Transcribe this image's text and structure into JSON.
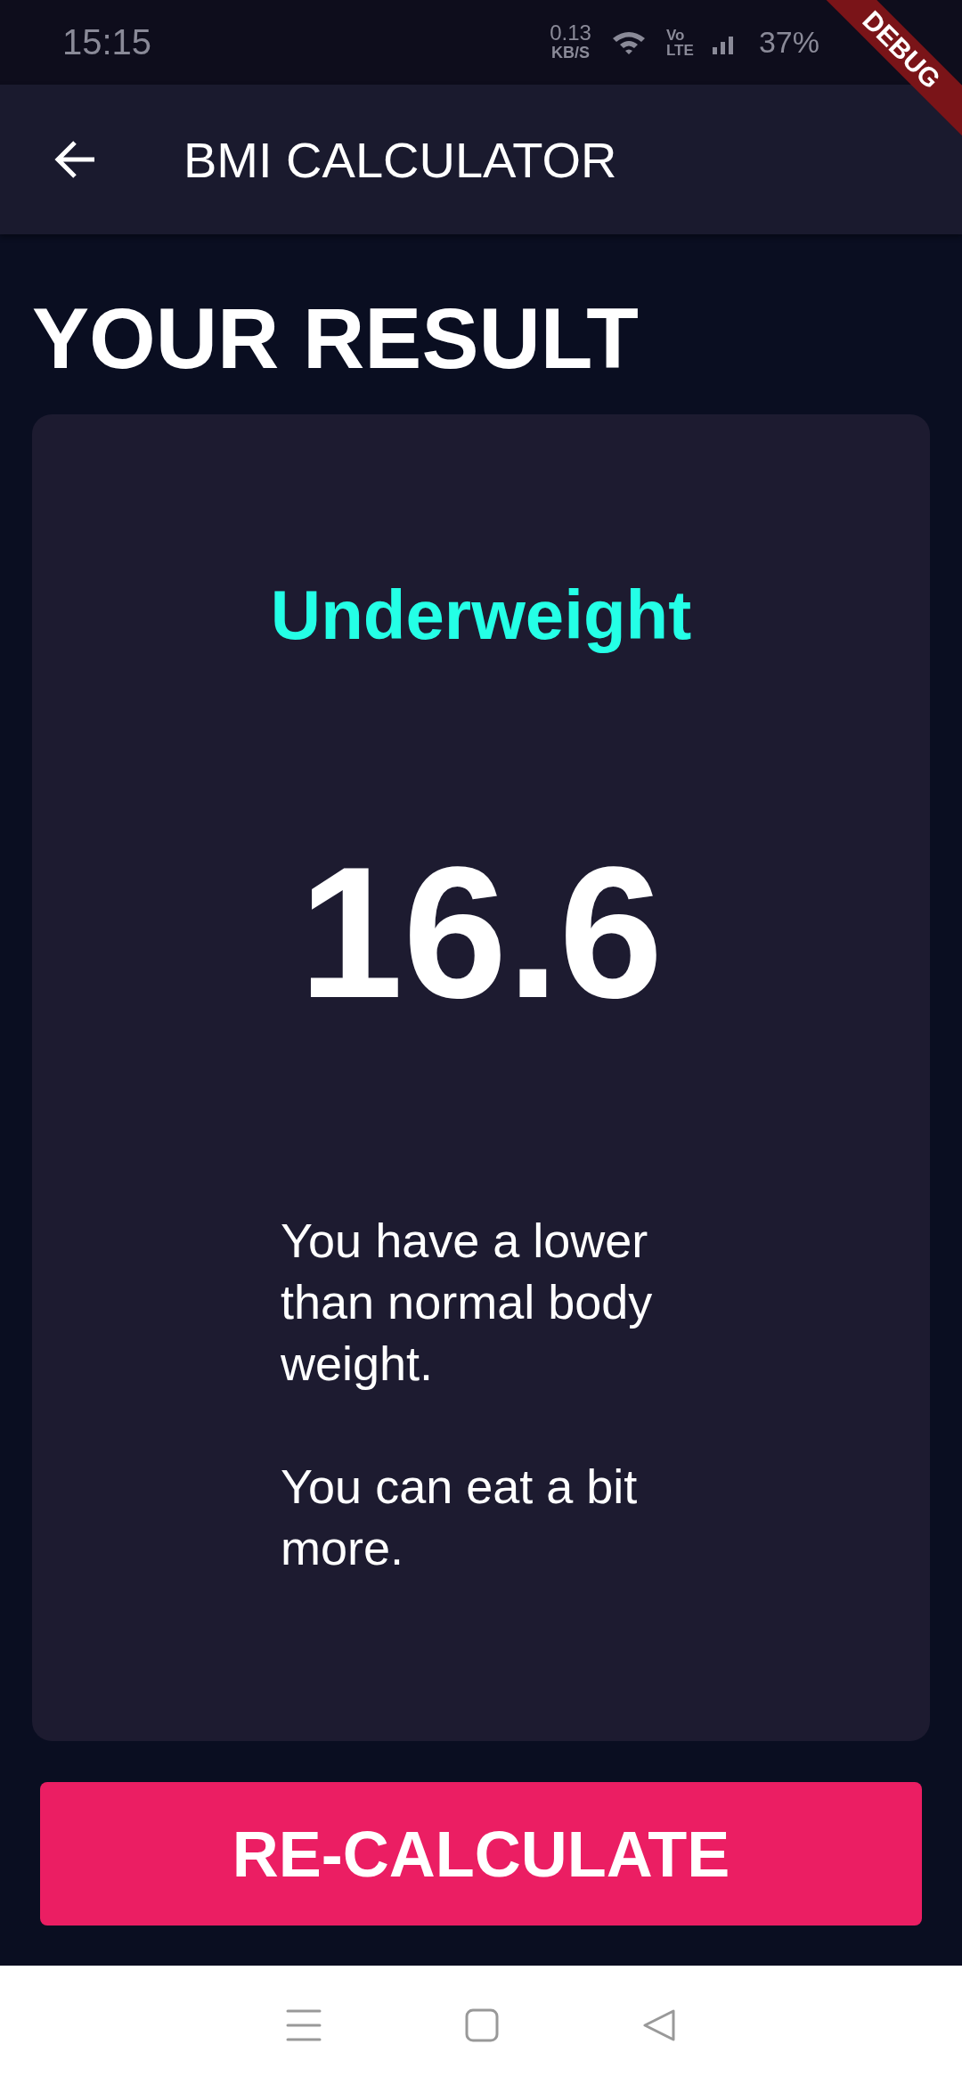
{
  "status_bar": {
    "time": "15:15",
    "network_speed": "0.13",
    "network_unit": "KB/S",
    "network_type": "Vo LTE",
    "battery": "37%"
  },
  "debug_banner": "DEBUG",
  "app_bar": {
    "title": "BMI CALCULATOR"
  },
  "heading": "YOUR RESULT",
  "result": {
    "category": "Underweight",
    "bmi": "16.6",
    "interpretation": "You have a lower than normal body weight.\n\nYou can eat a bit more."
  },
  "button": "RE-CALCULATE"
}
